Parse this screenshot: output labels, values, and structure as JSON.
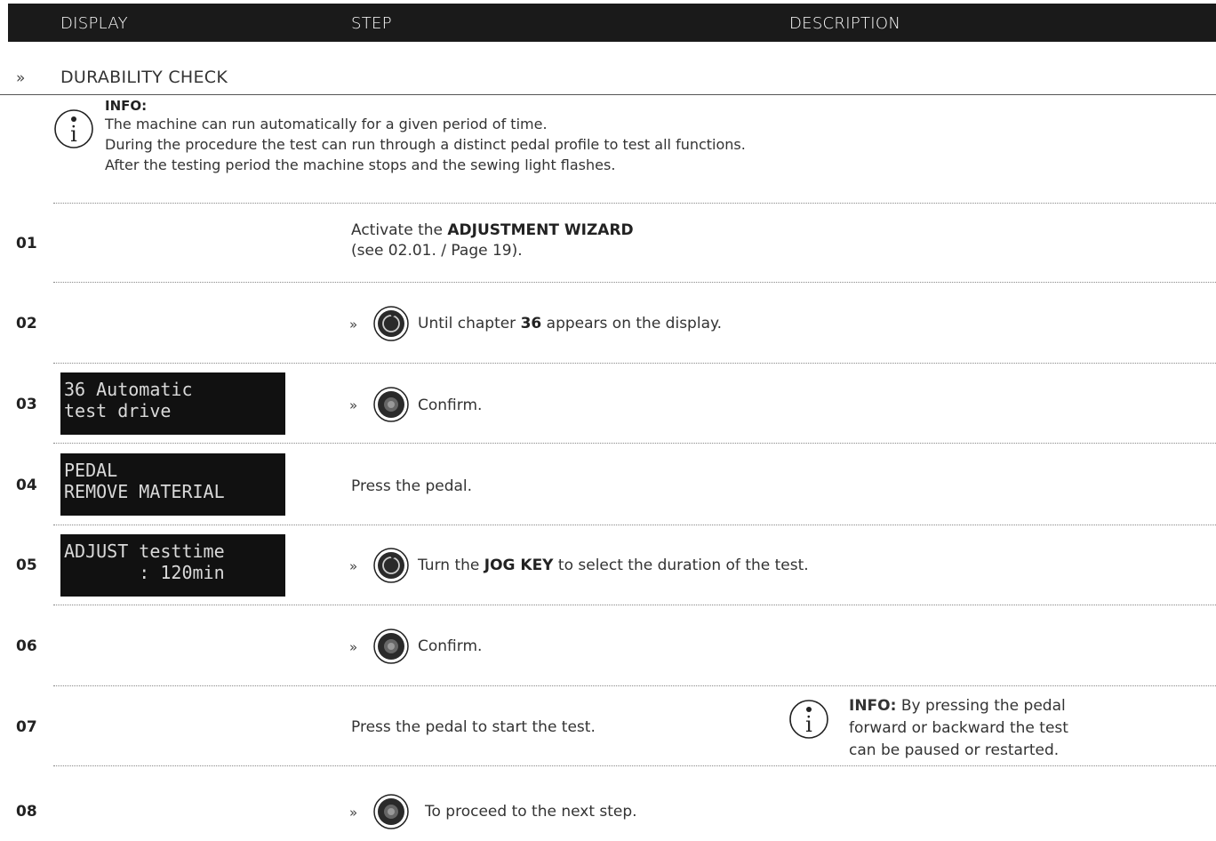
{
  "header": {
    "col_display": "DISPLAY",
    "col_step": "STEP",
    "col_description": "DESCRIPTION"
  },
  "section": {
    "marker": "»",
    "title": "DURABILITY CHECK"
  },
  "info": {
    "label": "INFO:",
    "lines": [
      "The machine can run automatically for a given period of time.",
      "During the procedure the test can run through a distinct pedal profile to test all functions.",
      "After the testing period the machine stops and the sewing light flashes."
    ],
    "icon": "info-icon"
  },
  "steps": [
    {
      "num": "01",
      "text_a": "Activate the ",
      "bold_a": "ADJUSTMENT WIZARD",
      "line2": "(see 02.01. / Page 19)."
    },
    {
      "num": "02",
      "marker": "»",
      "icon": "jog-dial-icon",
      "text_a": "Until chapter ",
      "bold_a": "36",
      "text_b": " appears on the display."
    },
    {
      "num": "03",
      "display": [
        "36 Automatic",
        "test drive"
      ],
      "marker": "»",
      "icon": "confirm-button-icon",
      "text_a": "Confirm."
    },
    {
      "num": "04",
      "display": [
        "PEDAL",
        "REMOVE MATERIAL"
      ],
      "text_a": "Press the pedal."
    },
    {
      "num": "05",
      "display": [
        "ADJUST testtime",
        "       : 120min"
      ],
      "marker": "»",
      "icon": "jog-dial-icon",
      "text_a": "Turn the ",
      "bold_a": "JOG KEY",
      "text_b": " to select the duration of the test."
    },
    {
      "num": "06",
      "marker": "»",
      "icon": "confirm-button-icon",
      "text_a": "Confirm."
    },
    {
      "num": "07",
      "text_a": "Press the pedal to start the test.",
      "note_label": "INFO:",
      "note_lines": [
        " By pressing the pedal",
        "forward or backward the test",
        "can be paused or restarted."
      ]
    },
    {
      "num": "08",
      "marker": "»",
      "icon": "confirm-button-icon",
      "text_a": "To proceed to the next step."
    }
  ]
}
